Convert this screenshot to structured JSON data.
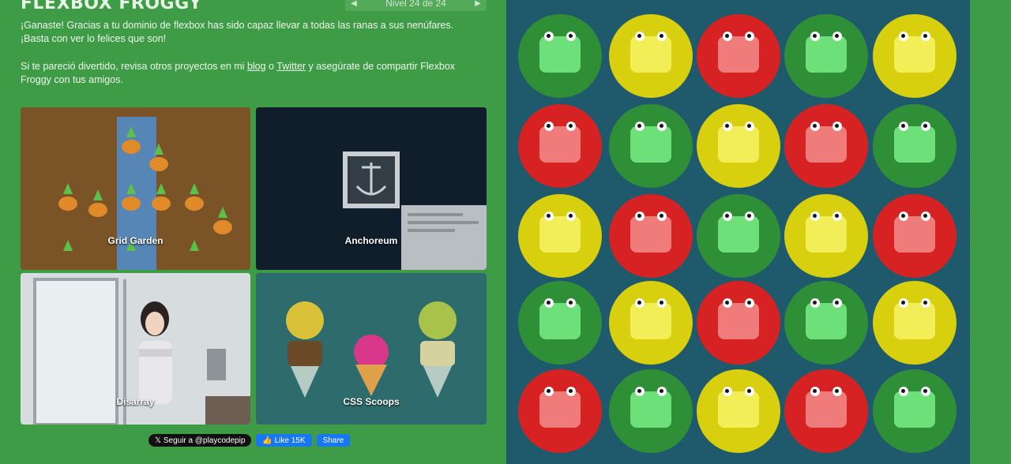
{
  "header": {
    "title": "FLEXBOX FROGGY",
    "level_label": "Nivel 24 de 24",
    "prev_arrow": "◀",
    "next_arrow": "▶"
  },
  "win_message": {
    "line1": "¡Ganaste! Gracias a tu dominio de flexbox has sido capaz llevar a todas las ranas a sus nenúfares. ¡Basta con ver lo felices que son!",
    "line2_a": "Si te pareció divertido, revisa otros proyectos en mi ",
    "blog_link": "blog",
    "line2_b": " o ",
    "twitter_link": "Twitter",
    "line2_c": " y asegúrate de compartir Flexbox Froggy con tus amigos."
  },
  "projects": [
    {
      "name": "Grid Garden"
    },
    {
      "name": "Anchoreum"
    },
    {
      "name": "Disarray"
    },
    {
      "name": "CSS Scoops"
    }
  ],
  "social": {
    "follow_label": "𝕏 Seguir a @playcodepip",
    "like_label": "👍 Like 15K",
    "share_label": "Share"
  },
  "board": {
    "rows": [
      [
        "green",
        "yellow",
        "red",
        "green",
        "yellow"
      ],
      [
        "red",
        "green",
        "yellow",
        "red",
        "green"
      ],
      [
        "yellow",
        "red",
        "green",
        "yellow",
        "red"
      ],
      [
        "green",
        "yellow",
        "red",
        "green",
        "yellow"
      ],
      [
        "red",
        "green",
        "yellow",
        "red",
        "green"
      ]
    ],
    "colors": {
      "green": {
        "pad": "#2f8f37",
        "frog": "#6ee07a"
      },
      "yellow": {
        "pad": "#d8cf0f",
        "frog": "#f2ee57"
      },
      "red": {
        "pad": "#d62222",
        "frog": "#f07b7b"
      }
    }
  }
}
